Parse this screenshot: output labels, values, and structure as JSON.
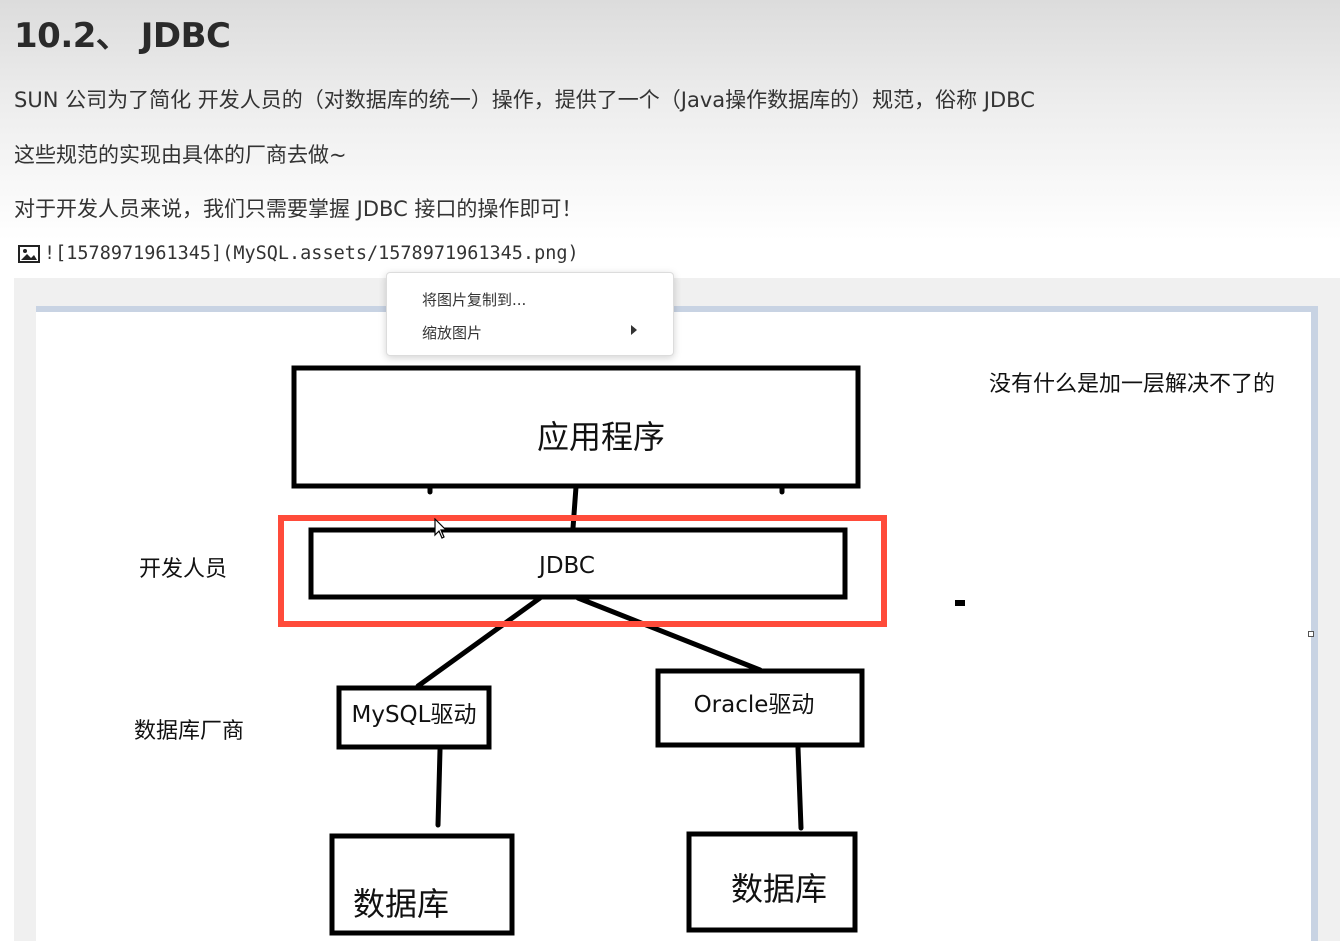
{
  "heading": "10.2、 JDBC",
  "paragraphs": [
    "SUN 公司为了简化 开发人员的（对数据库的统一）操作，提供了一个（Java操作数据库的）规范，俗称 JDBC",
    "这些规范的实现由具体的厂商去做~",
    "对于开发人员来说，我们只需要掌握 JDBC 接口的操作即可！"
  ],
  "image_markdown": "![1578971961345](MySQL.assets/1578971961345.png)",
  "icons": {
    "image": "image-icon",
    "submenu": "chevron-right-icon",
    "cursor": "mouse-pointer-icon"
  },
  "context_menu": {
    "items": [
      {
        "label": "将图片复制到..."
      },
      {
        "label": "缩放图片"
      }
    ]
  },
  "diagram": {
    "app_box": "应用程序",
    "jdbc_box": "JDBC",
    "developer_label": "开发人员",
    "vendor_label": "数据库厂商",
    "mysql_driver": "MySQL驱动",
    "oracle_driver": "Oracle驱动",
    "db_left": "数据库",
    "db_right": "数据库",
    "note": "没有什么是加一层解决不了的"
  },
  "colors": {
    "highlight": "#ff4b3a",
    "canvas_border": "#c8d3e3"
  }
}
